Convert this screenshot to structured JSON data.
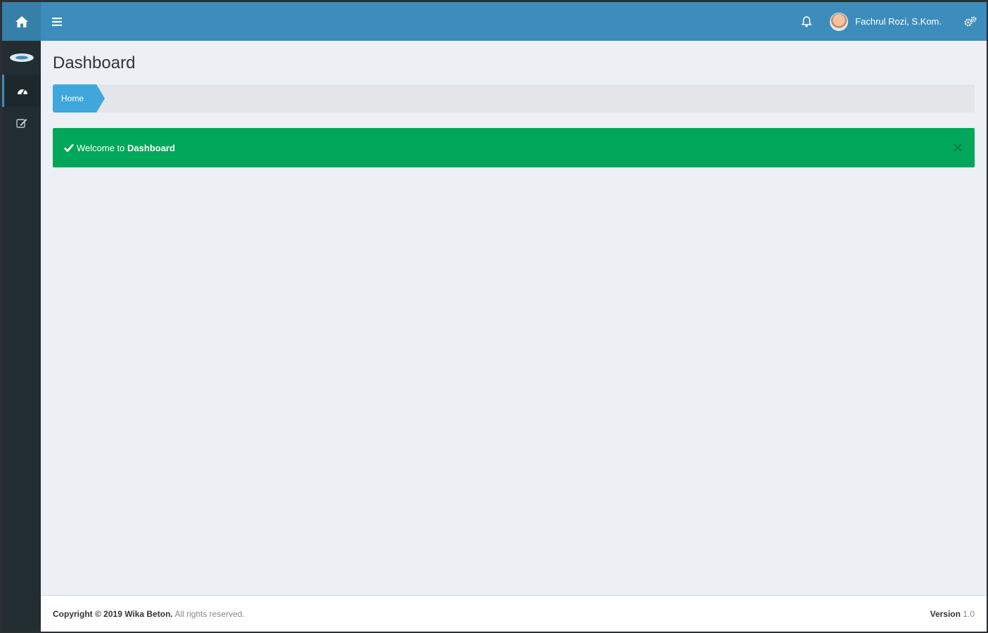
{
  "header": {
    "user_name": "Fachrul Rozi, S.Kom."
  },
  "page": {
    "title": "Dashboard"
  },
  "breadcrumb": {
    "items": [
      "Home"
    ]
  },
  "alert": {
    "prefix": "Welcome to",
    "emphasis": "Dashboard",
    "close_glyph": "×"
  },
  "footer": {
    "copyright_bold": "Copyright © 2019 Wika Beton.",
    "copyright_rest": "All rights reserved.",
    "version_label": "Version",
    "version_value": "1.0"
  },
  "icons": {
    "home": "home-icon",
    "menu": "hamburger-menu-icon",
    "bell": "bell-icon",
    "settings": "gears-icon",
    "brand": "brand-logo-icon",
    "dashboard": "dashboard-icon",
    "edit": "edit-icon",
    "check": "check-icon",
    "close": "close-icon"
  },
  "colors": {
    "header": "#3c8dbc",
    "sidebar": "#222d32",
    "content_bg": "#ecf0f5",
    "alert_success": "#00a65a",
    "breadcrumb_active": "#3fa7dc"
  }
}
